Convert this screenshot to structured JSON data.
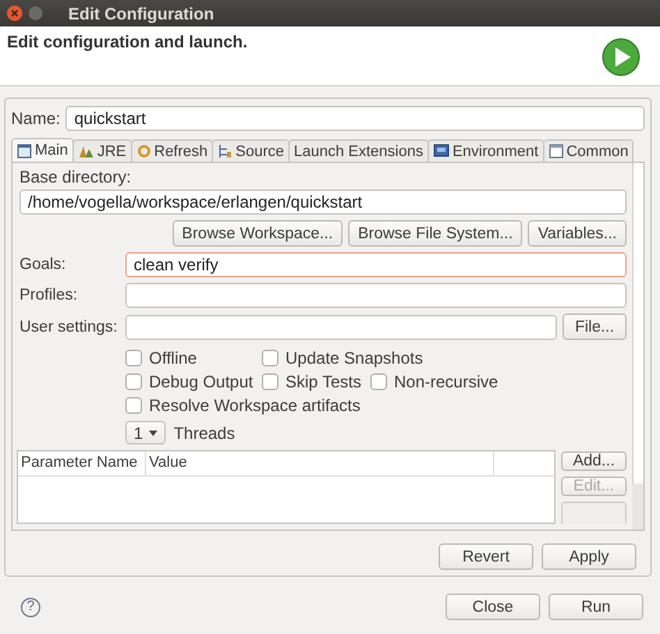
{
  "window": {
    "title": "Edit Configuration"
  },
  "header": {
    "text": "Edit configuration and launch."
  },
  "name": {
    "label": "Name:",
    "value": "quickstart"
  },
  "tabs": [
    {
      "label": "Main",
      "selected": true
    },
    {
      "label": "JRE",
      "selected": false
    },
    {
      "label": "Refresh",
      "selected": false
    },
    {
      "label": "Source",
      "selected": false
    },
    {
      "label": "Launch Extensions",
      "selected": false
    },
    {
      "label": "Environment",
      "selected": false
    },
    {
      "label": "Common",
      "selected": false
    }
  ],
  "base_directory": {
    "label": "Base directory:",
    "value": "/home/vogella/workspace/erlangen/quickstart",
    "buttons": [
      "Browse Workspace...",
      "Browse File System...",
      "Variables..."
    ]
  },
  "fields": [
    {
      "label": "Goals:",
      "value": "clean verify",
      "focused": true
    },
    {
      "label": "Profiles:",
      "focused": false
    },
    {
      "label": "User settings:",
      "focused": false,
      "button": "File..."
    }
  ],
  "checkbox_rows": [
    [
      {
        "label": "Offline",
        "checked": false
      },
      {
        "label": "Update Snapshots",
        "checked": false
      }
    ],
    [
      {
        "label": "Debug Output",
        "checked": false
      },
      {
        "label": "Skip Tests",
        "checked": false
      },
      {
        "label": "Non-recursive",
        "checked": false
      }
    ],
    [
      {
        "label": "Resolve Workspace artifacts",
        "checked": false
      }
    ]
  ],
  "threads": {
    "value": "1",
    "label": "Threads"
  },
  "parameters": {
    "columns": [
      "Parameter Name",
      "Value"
    ],
    "buttons": [
      {
        "label": "Add...",
        "disabled": false
      },
      {
        "label": "Edit...",
        "disabled": true
      }
    ]
  },
  "panel_buttons": [
    "Revert",
    "Apply"
  ],
  "help": "?",
  "dialog_buttons": [
    "Close",
    "Run"
  ]
}
